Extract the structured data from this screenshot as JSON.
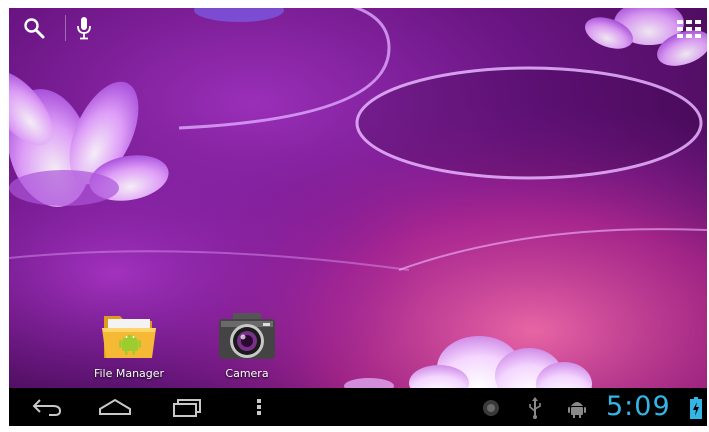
{
  "top_bar": {
    "search_icon": "search-icon",
    "voice_icon": "microphone-icon",
    "apps_icon": "all-apps-grid-icon"
  },
  "desktop": {
    "shortcuts": [
      {
        "label": "File Manager",
        "icon": "folder-android-icon"
      },
      {
        "label": "Camera",
        "icon": "camera-icon"
      }
    ]
  },
  "nav_bar": {
    "back_icon": "back-arrow-icon",
    "home_icon": "home-icon",
    "recent_icon": "recent-apps-icon",
    "menu_icon": "menu-dots-icon"
  },
  "status_bar": {
    "time": "5:09",
    "notification_icons": [
      "record-icon",
      "usb-icon",
      "android-debug-icon"
    ],
    "battery_icon": "battery-charging-icon",
    "clock_color": "#33b5e5"
  },
  "colors": {
    "wallpaper_dark": "#4a0a5a",
    "wallpaper_mid": "#8a1ca0",
    "wallpaper_pink": "#d83a9a",
    "nav_bar": "#000000"
  }
}
